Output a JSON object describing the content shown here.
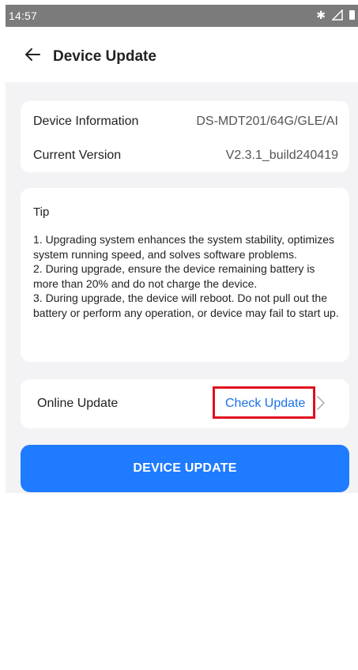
{
  "status_bar": {
    "time": "14:57",
    "icons": [
      "bluetooth-icon",
      "signal-icon",
      "battery-icon"
    ]
  },
  "header": {
    "back_icon": "arrow-left-icon",
    "title": "Device Update"
  },
  "device_info": {
    "rows": [
      {
        "label": "Device Information",
        "value": "DS-MDT201/64G/GLE/AI"
      },
      {
        "label": "Current Version",
        "value": "V2.3.1_build240419"
      }
    ]
  },
  "tip": {
    "title": "Tip",
    "items": [
      "1. Upgrading system enhances the system stability, optimizes system running speed, and solves software problems.",
      "2. During upgrade, ensure the device remaining battery is more than 20% and do not charge the device.",
      "3. During upgrade, the device will reboot. Do not pull out the battery or perform any operation, or device may fail to start up."
    ]
  },
  "online_update": {
    "label": "Online Update",
    "action": "Check Update",
    "chevron_icon": "chevron-right-icon"
  },
  "primary_button": {
    "label": "DEVICE UPDATE"
  },
  "colors": {
    "accent": "#1f7bff",
    "link": "#1a73e8",
    "highlight_box": "#e0101f",
    "status_bar": "#7b7b7b",
    "content_background": "#f3f3f5"
  }
}
